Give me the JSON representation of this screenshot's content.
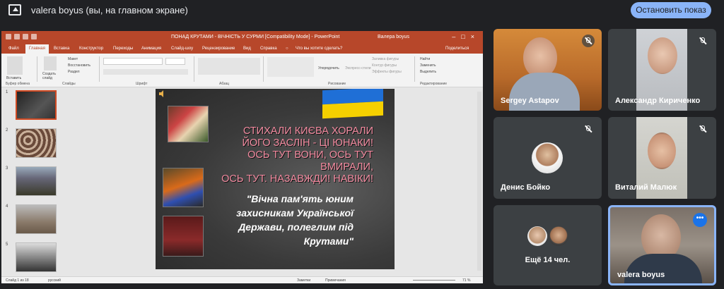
{
  "topbar": {
    "title": "valera boyus (вы, на главном экране)",
    "stop_button": "Остановить показ"
  },
  "powerpoint": {
    "window_title": "ПОНАД КРУТАМИ - ВІЧНІСТЬ У  СУРМИ [Compatibility Mode] - PowerPoint",
    "user": "Валера boyus",
    "tabs": [
      "Файл",
      "Главная",
      "Вставка",
      "Конструктор",
      "Переходы",
      "Анимация",
      "Слайд-шоу",
      "Рецензирование",
      "Вид",
      "Справка"
    ],
    "tell_me": "Что вы хотите сделать?",
    "share": "Поделиться",
    "ribbon": {
      "paste": "Вставить",
      "new_slide": "Создать слайд",
      "layout": "Макет",
      "reset": "Восстановить",
      "section": "Раздел",
      "arrange": "Упорядочить",
      "quick_styles": "Экспресс-стили",
      "shape_fill": "Заливка фигуры",
      "shape_outline": "Контур фигуры",
      "shape_effects": "Эффекты фигуры",
      "find": "Найти",
      "replace": "Заменить",
      "select": "Выделить",
      "groups": [
        "Буфер обмена",
        "Слайды",
        "Шрифт",
        "Абзац",
        "Рисование",
        "Редактирование"
      ]
    },
    "thumbnails": [
      "1",
      "2",
      "3",
      "4",
      "5"
    ],
    "slide": {
      "poem_lines": [
        "СТИХАЛИ КИЄВА ХОРАЛИ",
        "ЙОГО ЗАСЛІН - ЦІ ЮНАКИ!",
        "ОСЬ ТУТ ВОНИ, ОСЬ ТУТ ВМИРАЛИ,",
        "ОСЬ ТУТ. НАЗАВЖДИ! НАВІКИ!"
      ],
      "quote_lines": [
        "\"Вічна пам'ять юним",
        "захисникам Української",
        "Держави, полеглим під",
        "Крутами\""
      ]
    },
    "status": {
      "slide_info": "Слайд 1 из 18",
      "language": "русский",
      "notes": "Заметки",
      "comments": "Примечания",
      "zoom": "71 %"
    }
  },
  "participants": [
    {
      "name": "Sergey Astapov",
      "muted": true
    },
    {
      "name": "Александр Кириченко",
      "muted": true
    },
    {
      "name": "Денис Бойко",
      "muted": true
    },
    {
      "name": "Виталий Малюк",
      "muted": true
    },
    {
      "name": "Ещё 14 чел."
    },
    {
      "name": "valera boyus"
    }
  ],
  "colors": {
    "meet_bg": "#202124",
    "tile_bg": "#3c4043",
    "accent": "#8ab4f8",
    "ppt_brand": "#b7472a"
  }
}
